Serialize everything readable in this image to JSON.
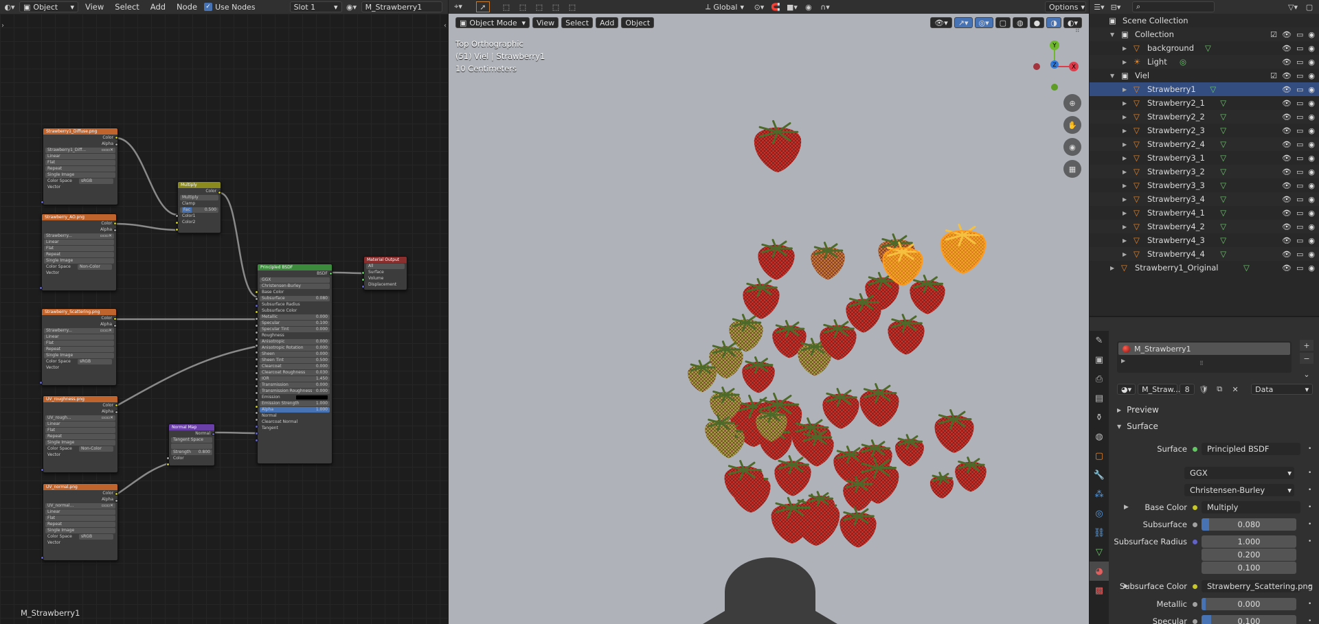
{
  "node_header": {
    "mode": "Object",
    "menus": [
      "View",
      "Select",
      "Add",
      "Node"
    ],
    "use_nodes_label": "Use Nodes",
    "slot": "Slot 1",
    "material": "M_Strawberry1"
  },
  "view_header": {
    "transform": "Global",
    "options": "Options"
  },
  "node_editor": {
    "footer_label": "M_Strawberry1",
    "nodes": {
      "tex1": {
        "title": "Strawberry1_Diffuse.png",
        "image": "Strawberry1_Diff...",
        "rows": [
          "Linear",
          "Flat",
          "Repeat",
          "Single Image"
        ],
        "colorspace_label": "Color Space",
        "colorspace": "sRGB",
        "vector": "Vector",
        "out_color": "Color",
        "out_alpha": "Alpha"
      },
      "tex2": {
        "title": "Strawberry_AO.png",
        "image": "Strawberry...",
        "rows": [
          "Linear",
          "Flat",
          "Repeat",
          "Single Image"
        ],
        "colorspace_label": "Color Space",
        "colorspace": "Non-Color",
        "vector": "Vector",
        "out_color": "Color",
        "out_alpha": "Alpha"
      },
      "tex3": {
        "title": "Strawberry_Scattering.png",
        "image": "Strawberry...",
        "rows": [
          "Linear",
          "Flat",
          "Repeat",
          "Single Image"
        ],
        "colorspace_label": "Color Space",
        "colorspace": "sRGB",
        "vector": "Vector",
        "out_color": "Color",
        "out_alpha": "Alpha"
      },
      "tex4": {
        "title": "UV_roughness.png",
        "image": "UV_rough...",
        "rows": [
          "Linear",
          "Flat",
          "Repeat",
          "Single Image"
        ],
        "colorspace_label": "Color Space",
        "colorspace": "Non-Color",
        "vector": "Vector",
        "out_color": "Color",
        "out_alpha": "Alpha"
      },
      "tex5": {
        "title": "UV_normal.png",
        "image": "UV_normal...",
        "rows": [
          "Linear",
          "Flat",
          "Repeat",
          "Single Image"
        ],
        "colorspace_label": "Color Space",
        "colorspace": "sRGB",
        "vector": "Vector",
        "out_color": "Color",
        "out_alpha": "Alpha"
      },
      "multiply": {
        "title": "Multiply",
        "out": "Color",
        "op": "Multiply",
        "clamp": "Clamp",
        "fac_label": "Fac",
        "fac": "0.500",
        "in1": "Color1",
        "in2": "Color2"
      },
      "normalmap": {
        "title": "Normal Map",
        "out": "Normal",
        "space": "Tangent Space",
        "strength_label": "Strength",
        "strength": "0.800",
        "color": "Color"
      },
      "output": {
        "title": "Material Output",
        "target": "All",
        "surface": "Surface",
        "volume": "Volume",
        "displacement": "Displacement"
      },
      "bsdf": {
        "title": "Principled BSDF",
        "out": "BSDF",
        "dist": "GGX",
        "sss": "Christensen-Burley",
        "rows": [
          {
            "label": "Base Color",
            "value": ""
          },
          {
            "label": "Subsurface",
            "value": "0.080"
          },
          {
            "label": "Subsurface Radius",
            "value": ""
          },
          {
            "label": "Subsurface Color",
            "value": ""
          },
          {
            "label": "Metallic",
            "value": "0.000"
          },
          {
            "label": "Specular",
            "value": "0.100"
          },
          {
            "label": "Specular Tint",
            "value": "0.000"
          },
          {
            "label": "Roughness",
            "value": ""
          },
          {
            "label": "Anisotropic",
            "value": "0.000"
          },
          {
            "label": "Anisotropic Rotation",
            "value": "0.000"
          },
          {
            "label": "Sheen",
            "value": "0.000"
          },
          {
            "label": "Sheen Tint",
            "value": "0.500"
          },
          {
            "label": "Clearcoat",
            "value": "0.000"
          },
          {
            "label": "Clearcoat Roughness",
            "value": "0.030"
          },
          {
            "label": "IOR",
            "value": "1.450"
          },
          {
            "label": "Transmission",
            "value": "0.000"
          },
          {
            "label": "Transmission Roughness",
            "value": "0.000"
          },
          {
            "label": "Emission",
            "value": ""
          },
          {
            "label": "Emission Strength",
            "value": "1.000"
          },
          {
            "label": "Alpha",
            "value": "1.000"
          },
          {
            "label": "Normal",
            "value": ""
          },
          {
            "label": "Clearcoat Normal",
            "value": ""
          },
          {
            "label": "Tangent",
            "value": ""
          }
        ]
      }
    }
  },
  "viewport": {
    "mode": "Object Mode",
    "menus": [
      "View",
      "Select",
      "Add",
      "Object"
    ],
    "info_view": "Top Orthographic",
    "info_object": "(51) Viel | Strawberry1",
    "info_scale": "10 Centimeters",
    "gizmo": {
      "y": "Y",
      "z": "Z",
      "x": "X"
    }
  },
  "outliner": {
    "rows": [
      {
        "label": "Scene Collection",
        "indent": 0,
        "kind": "scene"
      },
      {
        "label": "Collection",
        "indent": 1,
        "kind": "collection"
      },
      {
        "label": "background",
        "indent": 2,
        "kind": "object"
      },
      {
        "label": "Light",
        "indent": 2,
        "kind": "light"
      },
      {
        "label": "Viel",
        "indent": 1,
        "kind": "collection"
      },
      {
        "label": "Strawberry1",
        "indent": 2,
        "kind": "object",
        "selected": true
      },
      {
        "label": "Strawberry2_1",
        "indent": 2,
        "kind": "object"
      },
      {
        "label": "Strawberry2_2",
        "indent": 2,
        "kind": "object"
      },
      {
        "label": "Strawberry2_3",
        "indent": 2,
        "kind": "object"
      },
      {
        "label": "Strawberry2_4",
        "indent": 2,
        "kind": "object"
      },
      {
        "label": "Strawberry3_1",
        "indent": 2,
        "kind": "object"
      },
      {
        "label": "Strawberry3_2",
        "indent": 2,
        "kind": "object"
      },
      {
        "label": "Strawberry3_3",
        "indent": 2,
        "kind": "object"
      },
      {
        "label": "Strawberry3_4",
        "indent": 2,
        "kind": "object"
      },
      {
        "label": "Strawberry4_1",
        "indent": 2,
        "kind": "object"
      },
      {
        "label": "Strawberry4_2",
        "indent": 2,
        "kind": "object"
      },
      {
        "label": "Strawberry4_3",
        "indent": 2,
        "kind": "object"
      },
      {
        "label": "Strawberry4_4",
        "indent": 2,
        "kind": "object"
      },
      {
        "label": "Strawberry1_Original",
        "indent": 1,
        "kind": "object"
      }
    ]
  },
  "properties": {
    "material_slot": "M_Strawberry1",
    "material_name": "M_Straw...",
    "users": "8",
    "link": "Data",
    "preview": "Preview",
    "surface_panel": "Surface",
    "fields": [
      {
        "label": "Surface",
        "value": "Principled BSDF",
        "kind": "link",
        "dot": "#63c763"
      },
      {
        "label": "",
        "value": "GGX",
        "kind": "dropdown"
      },
      {
        "label": "",
        "value": "Christensen-Burley",
        "kind": "dropdown"
      },
      {
        "label": "Base Color",
        "value": "Multiply",
        "kind": "link",
        "dot": "#c7c729",
        "expand": true
      },
      {
        "label": "Subsurface",
        "value": "0.080",
        "kind": "slider",
        "dot": "#a1a1a1",
        "fill": 0.08
      },
      {
        "label": "Subsurface Radius",
        "value": "1.000",
        "kind": "num",
        "dot": "#6363c7"
      },
      {
        "label": "",
        "value": "0.200",
        "kind": "num"
      },
      {
        "label": "",
        "value": "0.100",
        "kind": "num"
      },
      {
        "label": "Subsurface Color",
        "value": "Strawberry_Scattering.png",
        "kind": "link",
        "dot": "#c7c729",
        "expand": true
      },
      {
        "label": "Metallic",
        "value": "0.000",
        "kind": "slider",
        "dot": "#a1a1a1",
        "fill": 0
      },
      {
        "label": "Specular",
        "value": "0.100",
        "kind": "slider",
        "dot": "#a1a1a1",
        "fill": 0.1
      }
    ]
  }
}
